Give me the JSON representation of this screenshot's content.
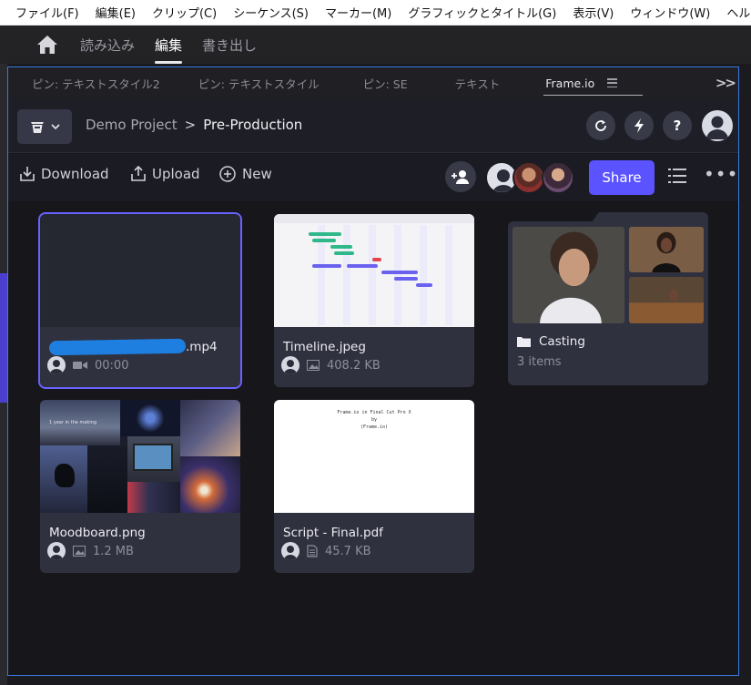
{
  "menubar": [
    "ファイル(F)",
    "編集(E)",
    "クリップ(C)",
    "シーケンス(S)",
    "マーカー(M)",
    "グラフィックとタイトル(G)",
    "表示(V)",
    "ウィンドウ(W)",
    "ヘルプ(H)"
  ],
  "workspace": {
    "tabs": [
      "読み込み",
      "編集",
      "書き出し"
    ],
    "active": "編集"
  },
  "panel_tabs": [
    "ピン: テキストスタイル2",
    "ピン: テキストスタイル",
    "ピン: SE",
    "テキスト",
    "Frame.io"
  ],
  "breadcrumb": {
    "project": "Demo Project",
    "separator": ">",
    "current": "Pre-Production"
  },
  "toolbar": {
    "download": "Download",
    "upload": "Upload",
    "new": "New",
    "share": "Share"
  },
  "header_buttons": {
    "help": "?"
  },
  "assets": [
    {
      "name": ".mp4",
      "meta": "00:00",
      "type": "video"
    },
    {
      "name": "Timeline.jpeg",
      "meta": "408.2 KB",
      "type": "image"
    },
    {
      "name": "Moodboard.png",
      "meta": "1.2 MB",
      "type": "image"
    },
    {
      "name": "Script - Final.pdf",
      "meta": "45.7 KB",
      "type": "document"
    }
  ],
  "folder": {
    "name": "Casting",
    "count": "3 items"
  },
  "thumb_texts": {
    "moodboard_caption": "1 year in the making",
    "script_line1": "Frame.io in Final Cut Pro X",
    "script_line2": "by",
    "script_line3": "(Frame.io)"
  },
  "colors": {
    "accent": "#5b53ff",
    "selection": "#6a62ff",
    "panel_border": "#3b7ae0"
  }
}
